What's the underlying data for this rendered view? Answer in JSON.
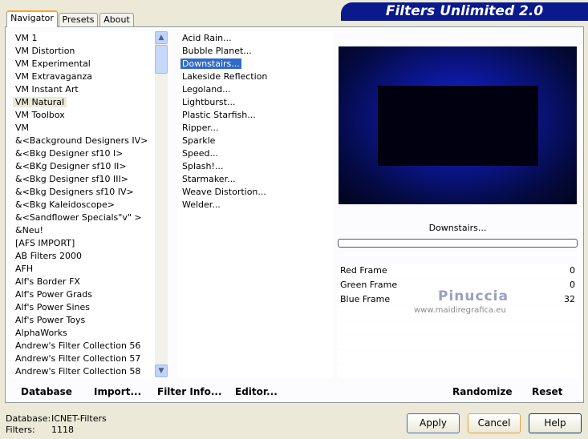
{
  "title": "Filters Unlimited 2.0",
  "tabs": [
    "Navigator",
    "Presets",
    "About"
  ],
  "categories": [
    "VM 1",
    "VM Distortion",
    "VM Experimental",
    "VM Extravaganza",
    "VM Instant Art",
    "VM Natural",
    "VM Toolbox",
    "VM",
    "&<Background Designers IV>",
    "&<Bkg Designer sf10 I>",
    "&<BKg Designer sf10 II>",
    "&<Bkg Designer sf10 III>",
    "&<Bkg Designers sf10 IV>",
    "&<Bkg Kaleidoscope>",
    "&<Sandflower Specials\"v\" >",
    "&Neu!",
    "[AFS IMPORT]",
    "AB Filters 2000",
    "AFH",
    "Alf's Border FX",
    "Alf's Power Grads",
    "Alf's Power Sines",
    "Alf's Power Toys",
    "AlphaWorks",
    "Andrew's Filter Collection 56",
    "Andrew's Filter Collection 57",
    "Andrew's Filter Collection 58"
  ],
  "selected_category": "VM Natural",
  "filters": [
    "Acid Rain...",
    "Bubble Planet...",
    "Downstairs...",
    "Lakeside Reflection",
    "Legoland...",
    "Lightburst...",
    "Plastic Starfish...",
    "Ripper...",
    "Sparkle",
    "Speed...",
    "Splash!...",
    "Starmaker...",
    "Weave Distortion...",
    "Welder..."
  ],
  "selected_filter": "Downstairs...",
  "filter_name": "Downstairs...",
  "params": [
    {
      "label": "Red Frame",
      "value": "0"
    },
    {
      "label": "Green Frame",
      "value": "0"
    },
    {
      "label": "Blue Frame",
      "value": "32"
    }
  ],
  "watermark": {
    "name": "Pinuccia",
    "url": "www.maidiregrafica.eu"
  },
  "bottom_bar": {
    "database": "Database",
    "import": "Import...",
    "filter_info": "Filter Info...",
    "editor": "Editor...",
    "randomize": "Randomize",
    "reset": "Reset"
  },
  "status": {
    "database_label": "Database:",
    "database_value": "ICNET-Filters",
    "filters_label": "Filters:",
    "filters_value": "1118"
  },
  "buttons": {
    "apply": "Apply",
    "cancel": "Cancel",
    "help": "Help"
  }
}
